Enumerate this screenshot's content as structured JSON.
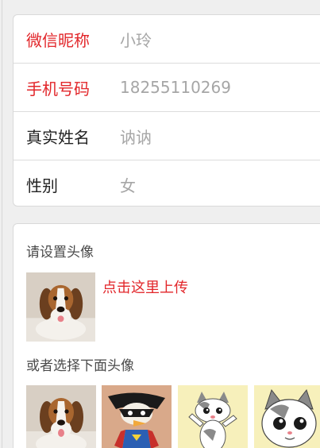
{
  "profile": {
    "fields": [
      {
        "label": "微信昵称",
        "value": "小玲",
        "label_color": "#e2262a"
      },
      {
        "label": "手机号码",
        "value": "18255110269",
        "label_color": "#e2262a"
      },
      {
        "label": "真实姓名",
        "value": "讷讷",
        "label_color": "#222222"
      },
      {
        "label": "性别",
        "value": "女",
        "label_color": "#222222"
      }
    ]
  },
  "avatar": {
    "set_title": "请设置头像",
    "upload_link": "点击这里上传",
    "choose_title": "或者选择下面头像",
    "current_icon": "beagle-puppy-avatar",
    "options": [
      {
        "icon": "beagle-puppy-avatar"
      },
      {
        "icon": "cartoon-superhero-bird-avatar"
      },
      {
        "icon": "cartoon-kitten-chi-avatar"
      },
      {
        "icon": "cartoon-kitten-chi-face-avatar"
      }
    ]
  },
  "colors": {
    "accent_red": "#e2262a",
    "value_gray": "#a6a6a6",
    "background": "#efefef"
  }
}
